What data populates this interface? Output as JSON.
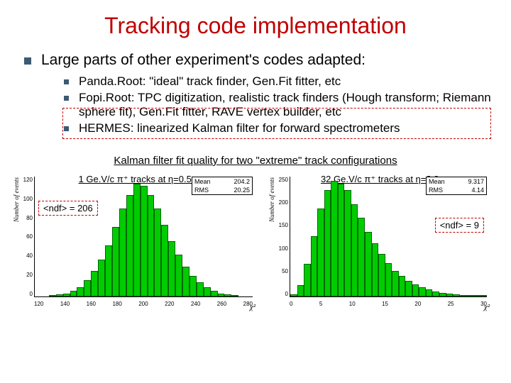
{
  "title": "Tracking code implementation",
  "main_bullet": "Large parts of other experiment's codes adapted:",
  "sub_bullets": [
    "Panda.Root: \"ideal\" track finder, Gen.Fit fitter, etc",
    "Fopi.Root: TPC digitization, realistic track finders (Hough transform; Riemann sphere fit), Gen.Fit fitter, RAVE vertex builder, etc",
    "HERMES: linearized Kalman filter for forward spectrometers"
  ],
  "chart_section_title": "Kalman filter fit quality for two \"extreme\" track configurations",
  "chart_data": [
    {
      "type": "bar",
      "title": "",
      "ylabel": "Number of events",
      "xlabel": "χ²",
      "xlim": [
        120,
        280
      ],
      "ylim": [
        0,
        130
      ],
      "xticks": [
        120,
        140,
        160,
        180,
        200,
        220,
        240,
        260,
        280
      ],
      "yticks": [
        0,
        20,
        40,
        60,
        80,
        100,
        120
      ],
      "stats": {
        "Mean": "204.2",
        "RMS": "20.25"
      },
      "annotation": "<ndf> = 206",
      "caption": "1 Ge.V/c π⁺ tracks at η=0.5:",
      "x": [
        125,
        130,
        135,
        140,
        145,
        150,
        155,
        160,
        165,
        170,
        175,
        180,
        185,
        190,
        195,
        200,
        205,
        210,
        215,
        220,
        225,
        230,
        235,
        240,
        245,
        250,
        255,
        260,
        265,
        270,
        275
      ],
      "values": [
        0,
        0,
        1,
        2,
        3,
        6,
        10,
        18,
        28,
        40,
        55,
        75,
        95,
        110,
        122,
        120,
        110,
        95,
        78,
        60,
        45,
        32,
        22,
        15,
        10,
        6,
        3,
        2,
        1,
        0,
        0
      ]
    },
    {
      "type": "bar",
      "title": "",
      "ylabel": "Number of events",
      "xlabel": "χ²",
      "xlim": [
        0,
        30
      ],
      "ylim": [
        0,
        260
      ],
      "xticks": [
        0,
        5,
        10,
        15,
        20,
        25,
        30
      ],
      "yticks": [
        0,
        50,
        100,
        150,
        200,
        250
      ],
      "stats": {
        "Mean": "9.317",
        "RMS": "4.14"
      },
      "annotation": "<ndf> = 9",
      "caption": "32 Ge.V/c π⁺ tracks at η=3.0:",
      "x": [
        1,
        2,
        3,
        4,
        5,
        6,
        7,
        8,
        9,
        10,
        11,
        12,
        13,
        14,
        15,
        16,
        17,
        18,
        19,
        20,
        21,
        22,
        23,
        24,
        25,
        26,
        27,
        28,
        29
      ],
      "values": [
        5,
        25,
        70,
        130,
        190,
        230,
        250,
        245,
        230,
        200,
        170,
        140,
        115,
        92,
        72,
        56,
        44,
        34,
        26,
        20,
        15,
        11,
        8,
        6,
        4,
        3,
        2,
        1,
        1
      ]
    }
  ]
}
